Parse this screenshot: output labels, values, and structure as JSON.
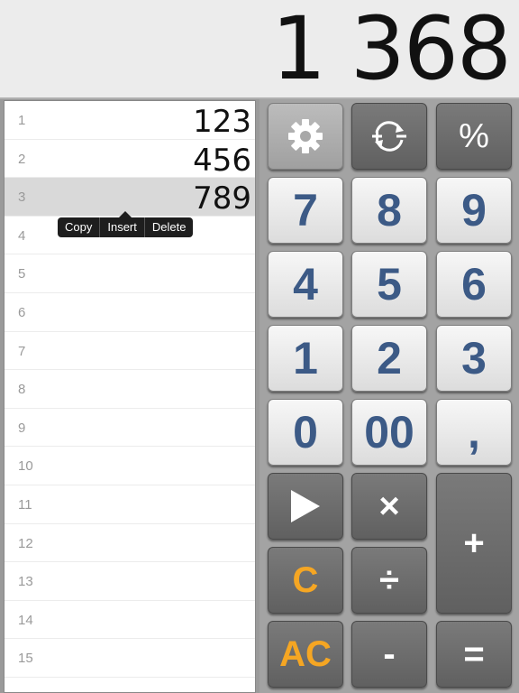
{
  "display": {
    "value": "1 368"
  },
  "tape": {
    "rows": [
      {
        "num": "1",
        "val": "123"
      },
      {
        "num": "2",
        "val": "456"
      },
      {
        "num": "3",
        "val": "789"
      },
      {
        "num": "4",
        "val": ""
      },
      {
        "num": "5",
        "val": ""
      },
      {
        "num": "6",
        "val": ""
      },
      {
        "num": "7",
        "val": ""
      },
      {
        "num": "8",
        "val": ""
      },
      {
        "num": "9",
        "val": ""
      },
      {
        "num": "10",
        "val": ""
      },
      {
        "num": "11",
        "val": ""
      },
      {
        "num": "12",
        "val": ""
      },
      {
        "num": "13",
        "val": ""
      },
      {
        "num": "14",
        "val": ""
      },
      {
        "num": "15",
        "val": ""
      }
    ],
    "selected_row": 3
  },
  "context_menu": {
    "copy": "Copy",
    "insert": "Insert",
    "delete": "Delete"
  },
  "keys": {
    "percent": "%",
    "seven": "7",
    "eight": "8",
    "nine": "9",
    "four": "4",
    "five": "5",
    "six": "6",
    "one": "1",
    "two": "2",
    "three": "3",
    "zero": "0",
    "double_zero": "00",
    "comma": ",",
    "multiply": "×",
    "plus": "+",
    "clear": "C",
    "divide": "÷",
    "all_clear": "AC",
    "minus": "-",
    "equals": "="
  },
  "colors": {
    "digit": "#3c5a86",
    "clear": "#f5a623",
    "operator_bg": "#6c6c6c"
  }
}
